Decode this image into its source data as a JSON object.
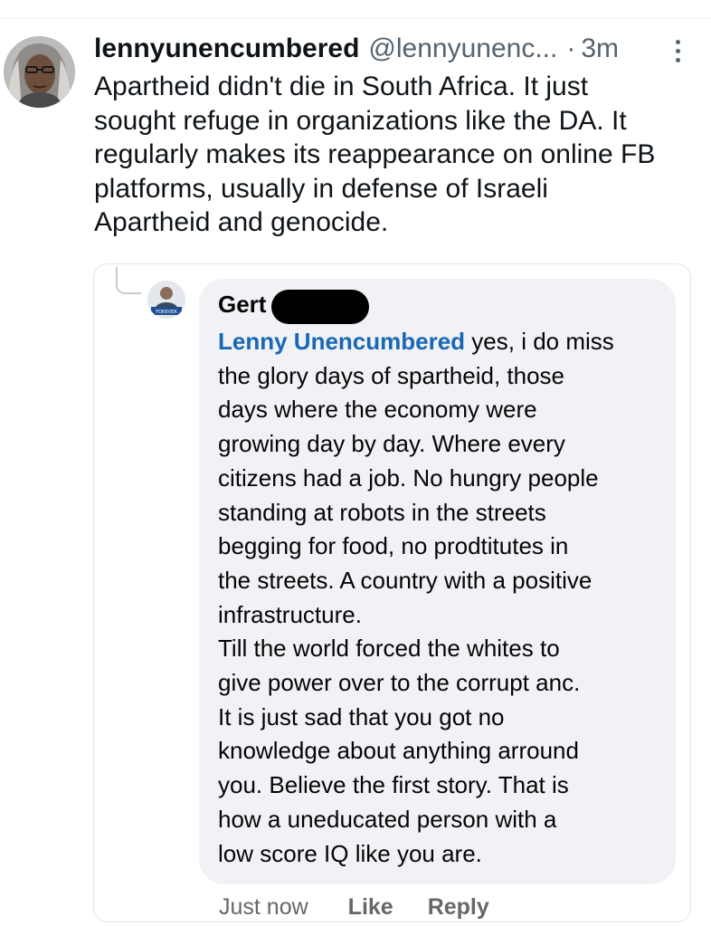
{
  "tweet": {
    "display_name": "lennyunencumbered",
    "handle": "@lennyunenc...",
    "separator": "·",
    "time": "3m",
    "more_icon": "more-vertical-icon",
    "text_lines": [
      "Apartheid didn't die in South Africa. It just",
      "sought refuge in organizations like the DA. It",
      "regularly makes its reappearance on online FB",
      "platforms, usually in defense of Israeli",
      "Apartheid and genocide."
    ]
  },
  "fb_comment": {
    "commenter_name": "Gert",
    "mention": "Lenny Unencumbered",
    "first_line_rest": "yes, i do miss",
    "text_lines": [
      "the glory days of spartheid, those",
      "days where the economy were",
      "growing day by day. Where every",
      "citizens had a job. No hungry people",
      "standing at robots in the streets",
      "begging for food, no prodtitutes in",
      "the streets. A country with a positive",
      "infrastructure.",
      "Till the world forced the whites to",
      "give power over to the corrupt anc.",
      "It is just sad that you got no",
      "knowledge about anything arround",
      "you. Believe the first story. That is",
      "how a uneducated person with a",
      "low score IQ like you are."
    ],
    "avatar_badge": "FOREVER",
    "actions": {
      "time": "Just now",
      "like": "Like",
      "reply": "Reply"
    }
  },
  "colors": {
    "link_blue": "#1967b5",
    "bubble_bg": "#f0f2f5",
    "secondary_text": "#536471",
    "fb_secondary_text": "#65676b"
  }
}
